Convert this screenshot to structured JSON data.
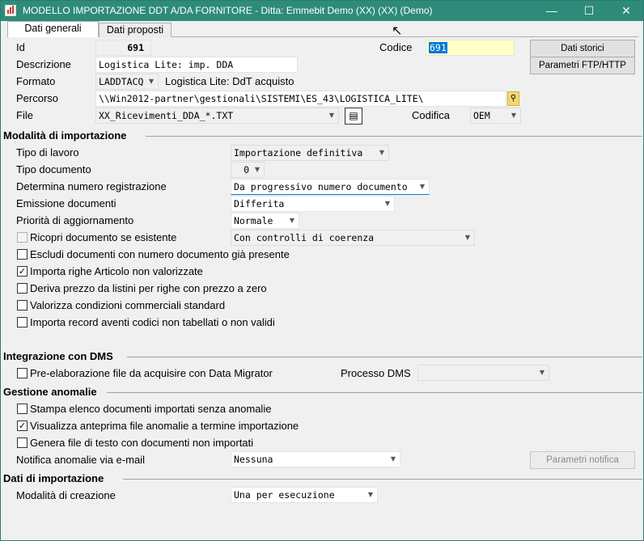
{
  "window": {
    "title": "MODELLO IMPORTAZIONE DDT A/DA FORNITORE - Ditta: Emmebit Demo (XX) (XX)  (Demo)"
  },
  "tabs": [
    {
      "label": "Dati generali"
    },
    {
      "label": "Dati proposti"
    }
  ],
  "general": {
    "id_label": "Id",
    "id_value": "691",
    "descrizione_label": "Descrizione",
    "descrizione_value": "Logistica Lite: imp. DDA",
    "formato_label": "Formato",
    "formato_value": "LADDTACQ",
    "formato_desc": "Logistica Lite: DdT acquisto",
    "percorso_label": "Percorso",
    "percorso_value": "\\\\Win2012-partner\\gestionali\\SISTEMI\\ES_43\\LOGISTICA_LITE\\",
    "file_label": "File",
    "file_value": "XX_Ricevimenti_DDA_*.TXT",
    "codice_label": "Codice",
    "codice_value": "691",
    "codifica_label": "Codifica",
    "codifica_value": "OEM",
    "btn_dati_storici": "Dati storici",
    "btn_parametri_ftp": "Parametri FTP/HTTP"
  },
  "importazione": {
    "title": "Modalità di importazione",
    "tipo_lavoro_label": "Tipo di lavoro",
    "tipo_lavoro_value": "Importazione definitiva",
    "tipo_documento_label": "Tipo documento",
    "tipo_documento_value": "0",
    "determina_label": "Determina numero registrazione",
    "determina_value": "Da progressivo numero documento",
    "emissione_label": "Emissione documenti",
    "emissione_value": "Differita",
    "priorita_label": "Priorità di aggiornamento",
    "priorita_value": "Normale",
    "ricopri_label": "Ricopri documento se esistente",
    "ricopri_value": "Con controlli di coerenza",
    "escludi_label": "Escludi documenti con numero documento già presente",
    "importa_righe_label": "Importa righe Articolo non valorizzate",
    "deriva_label": "Deriva prezzo da listini per righe con prezzo a zero",
    "valorizza_label": "Valorizza condizioni commerciali standard",
    "importa_record_label": "Importa record aventi codici non tabellati o non validi"
  },
  "dms": {
    "title": "Integrazione con DMS",
    "pre_label": "Pre-elaborazione file da acquisire con Data Migrator",
    "processo_label": "Processo DMS",
    "processo_value": ""
  },
  "anomalie": {
    "title": "Gestione anomalie",
    "stampa_label": "Stampa elenco documenti importati senza anomalie",
    "visualizza_label": "Visualizza anteprima file anomalie a termine importazione",
    "genera_label": "Genera file di testo con documenti non importati",
    "notifica_label": "Notifica anomalie via e-mail",
    "notifica_value": "Nessuna",
    "btn_parametri_notifica": "Parametri notifica"
  },
  "dati_importazione": {
    "title": "Dati di importazione",
    "modalita_label": "Modalità di creazione",
    "modalita_value": "Una per esecuzione"
  },
  "checks": {
    "ricopri": false,
    "escludi": false,
    "importa_righe": true,
    "deriva": false,
    "valorizza": false,
    "importa_record": false,
    "pre": false,
    "stampa": false,
    "visualizza": true,
    "genera": false
  }
}
